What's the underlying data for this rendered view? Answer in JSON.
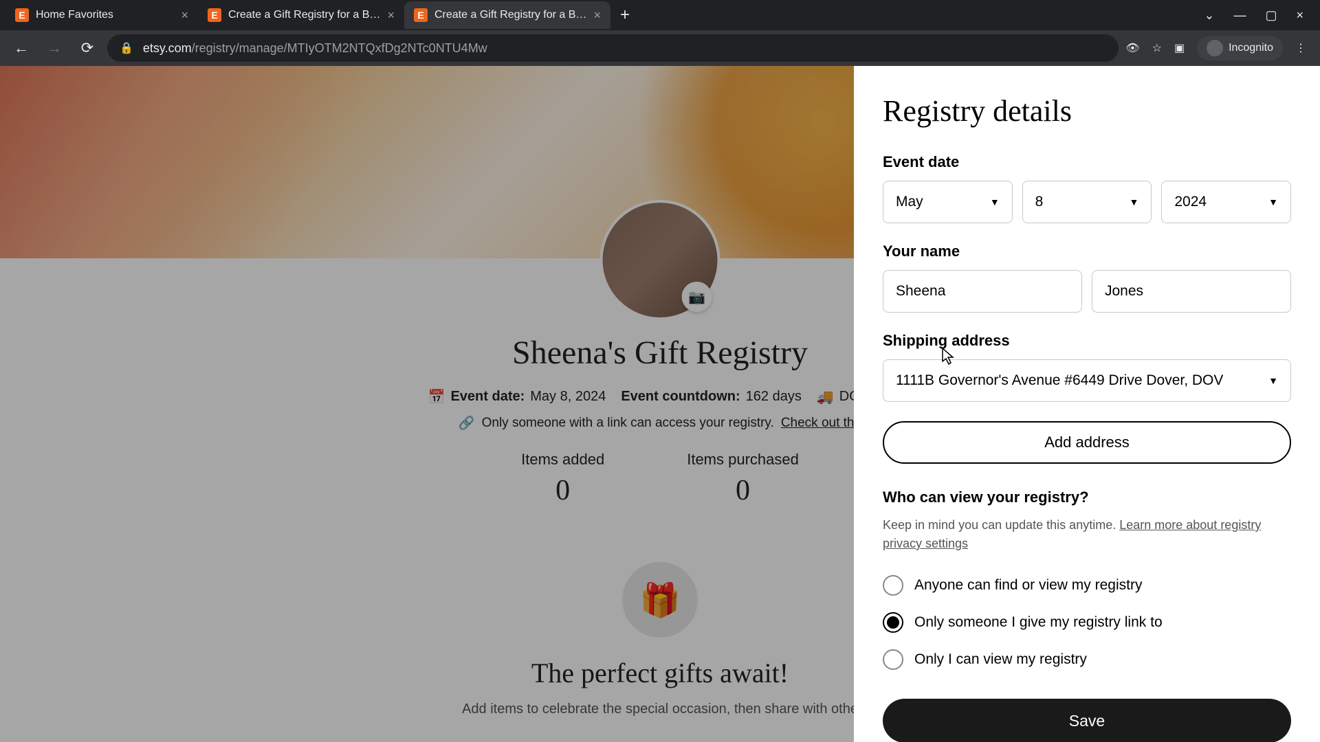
{
  "browser": {
    "tabs": [
      {
        "title": "Home Favorites",
        "active": false
      },
      {
        "title": "Create a Gift Registry for a Birth",
        "active": false
      },
      {
        "title": "Create a Gift Registry for a Birth",
        "active": true
      }
    ],
    "url_domain": "etsy.com",
    "url_path": "/registry/manage/MTIyOTM2NTQxfDg2NTc0NTU4Mw",
    "incognito_label": "Incognito"
  },
  "registry": {
    "title": "Sheena's Gift Registry",
    "event_date_label": "Event date:",
    "event_date_value": "May 8, 2024",
    "countdown_label": "Event countdown:",
    "countdown_value": "162 days",
    "location": "DOVER,",
    "privacy_text": "Only someone with a link can access your registry.",
    "privacy_link": "Check out the",
    "items_added_label": "Items added",
    "items_added_value": "0",
    "items_purchased_label": "Items purchased",
    "items_purchased_value": "0",
    "empty_title": "The perfect gifts await!",
    "empty_sub": "Add items to celebrate the special occasion, then share with othe"
  },
  "panel": {
    "title": "Registry details",
    "event_date_label": "Event date",
    "month": "May",
    "day": "8",
    "year": "2024",
    "your_name_label": "Your name",
    "first_name": "Sheena",
    "last_name": "Jones",
    "shipping_label": "Shipping address",
    "shipping_value": "1111B Governor's Avenue #6449 Drive Dover, DOV",
    "add_address": "Add address",
    "privacy_question": "Who can view your registry?",
    "privacy_hint_pre": "Keep in mind you can update this anytime. ",
    "privacy_hint_link": "Learn more about registry privacy settings",
    "radio_options": [
      {
        "label": "Anyone can find or view my registry",
        "checked": false
      },
      {
        "label": "Only someone I give my registry link to",
        "checked": true
      },
      {
        "label": "Only I can view my registry",
        "checked": false
      }
    ],
    "save": "Save"
  }
}
